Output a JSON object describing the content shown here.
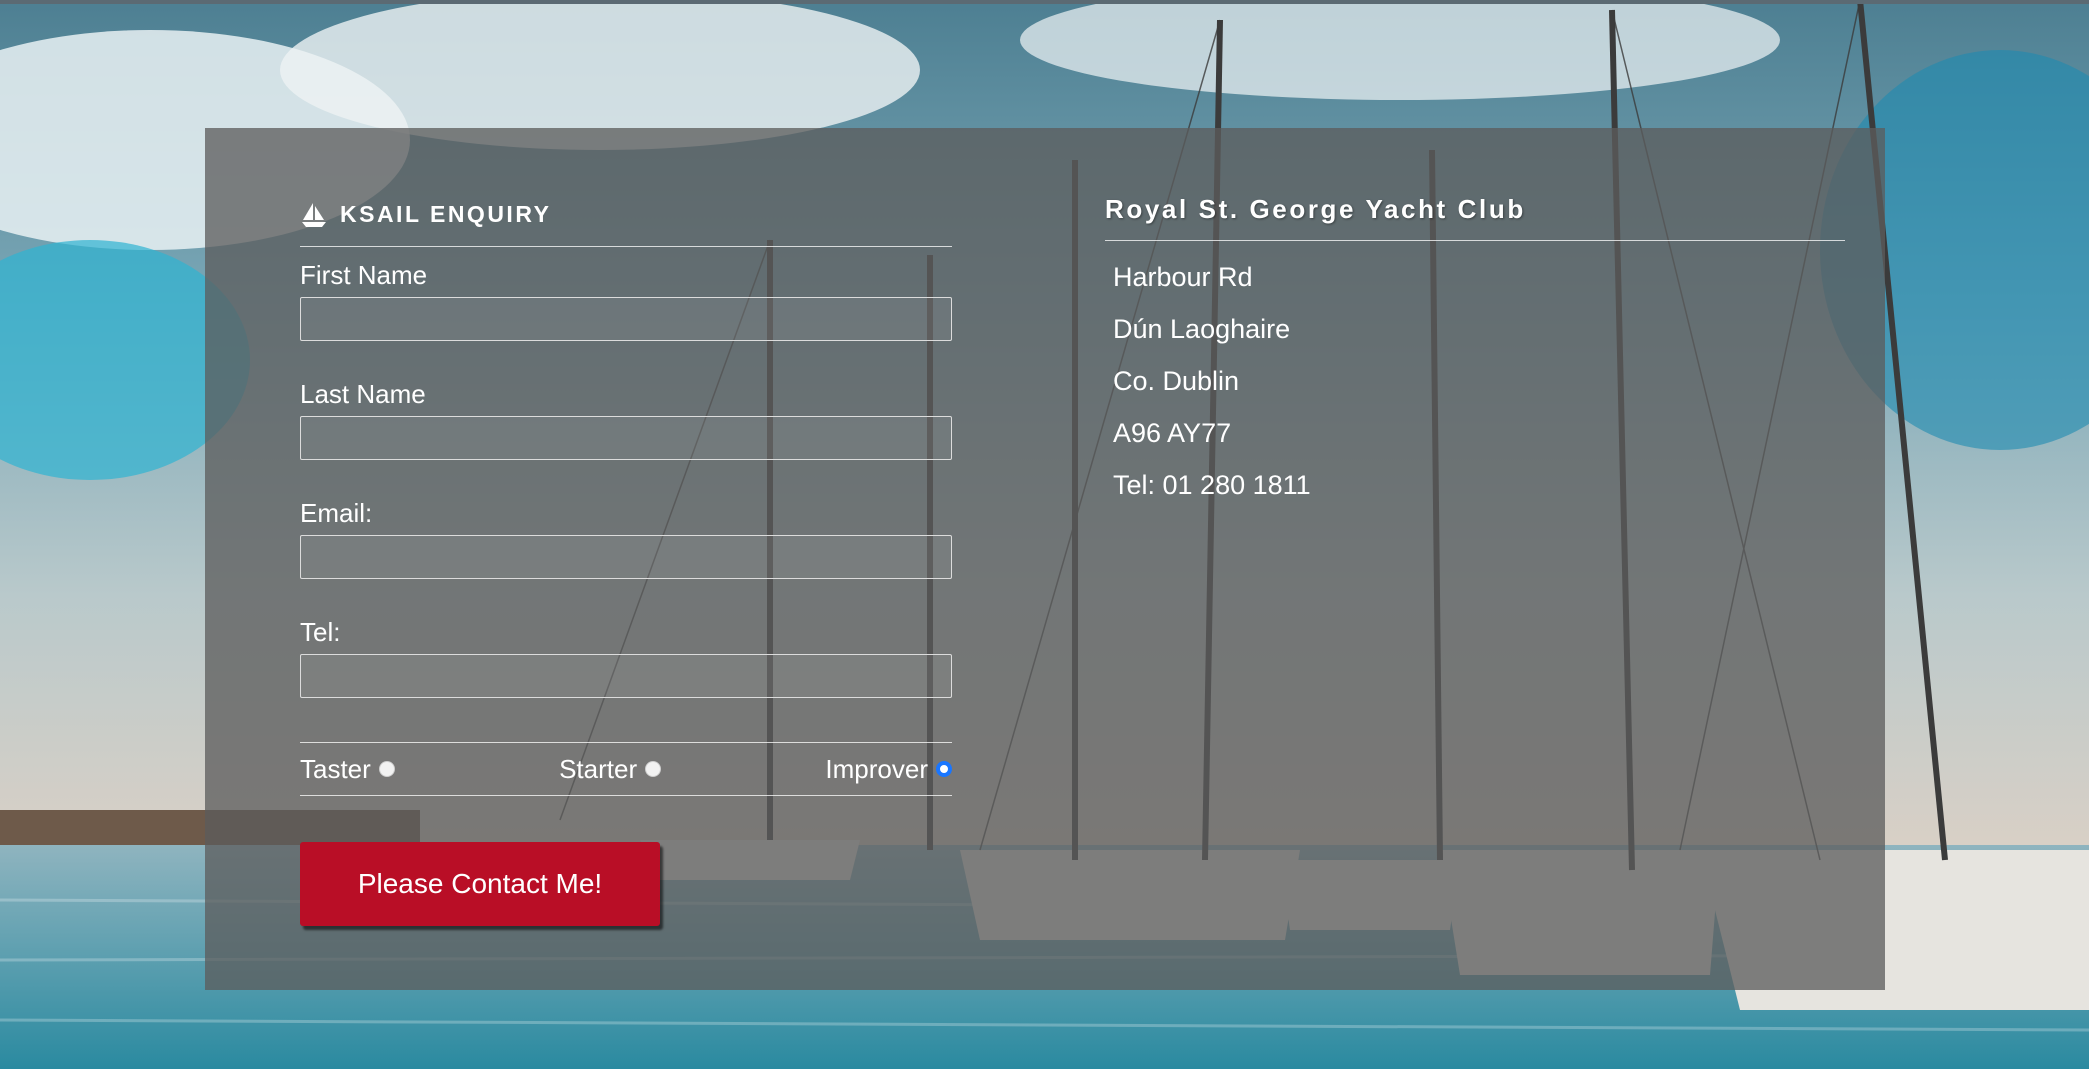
{
  "form": {
    "title": "KSAIL ENQUIRY",
    "icon": "sailboat-icon",
    "fields": [
      {
        "label": "First Name",
        "value": "",
        "placeholder": ""
      },
      {
        "label": "Last Name",
        "value": "",
        "placeholder": ""
      },
      {
        "label": "Email:",
        "value": "",
        "placeholder": ""
      },
      {
        "label": "Tel:",
        "value": "",
        "placeholder": ""
      }
    ],
    "levels": [
      {
        "label": "Taster",
        "checked": false
      },
      {
        "label": "Starter",
        "checked": false
      },
      {
        "label": "Improver",
        "checked": true
      }
    ],
    "submit_label": "Please Contact Me!"
  },
  "club": {
    "name": "Royal St. George Yacht Club",
    "address": [
      "Harbour Rd",
      "Dún Laoghaire",
      "Co. Dublin",
      "A96 AY77",
      "Tel: 01 280 1811"
    ]
  },
  "colors": {
    "panel": "#5c5c5c",
    "button": "#b90e26",
    "radio_accent": "#1976ff",
    "text": "#ffffff"
  }
}
